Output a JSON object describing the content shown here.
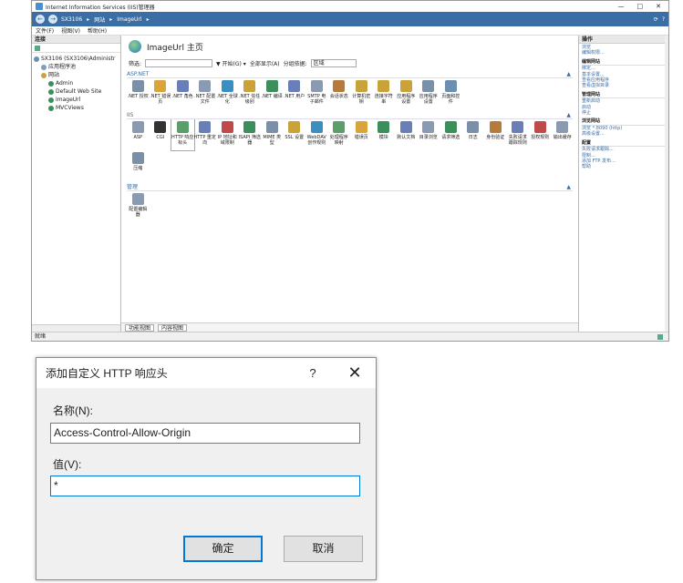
{
  "iis": {
    "title": "Internet Information Services (IIS)管理器",
    "window_controls": [
      "—",
      "□",
      "✕"
    ],
    "breadcrumb": [
      "SX3106",
      "网站",
      "ImageUrl"
    ],
    "menu": [
      "文件(F)",
      "视图(V)",
      "帮助(H)"
    ],
    "connections": {
      "header": "连接",
      "tree": [
        {
          "label": "SX3106 (SX3106\\Administr",
          "level": 0,
          "icon_color": "#6a8fb0"
        },
        {
          "label": "应用程序池",
          "level": 1,
          "icon_color": "#7a9fc0"
        },
        {
          "label": "网站",
          "level": 1,
          "icon_color": "#c9a23a"
        },
        {
          "label": "Admin",
          "level": 2,
          "icon_color": "#3a8f5a"
        },
        {
          "label": "Default Web Site",
          "level": 2,
          "icon_color": "#3a8f5a"
        },
        {
          "label": "ImageUrl",
          "level": 2,
          "icon_color": "#3a8f5a"
        },
        {
          "label": "MVCViews",
          "level": 2,
          "icon_color": "#3a8f5a"
        }
      ]
    },
    "center": {
      "title": "ImageUrl 主页",
      "filter_label": "筛选:",
      "go_label": "▼ 开始(G) ▾",
      "show_all_label": "全部显示(A)",
      "group_label": "分组依据:",
      "group_value": "区域",
      "sections": [
        {
          "name": "ASP.NET",
          "items": [
            {
              "label": ".NET 授权",
              "color": "#7a8fa8"
            },
            {
              "label": ".NET 错误页",
              "color": "#d9a43a"
            },
            {
              "label": ".NET 角色",
              "color": "#6a7fb8"
            },
            {
              "label": ".NET 配置文件",
              "color": "#8a9ab0"
            },
            {
              "label": ".NET 全球化",
              "color": "#3a8fc0"
            },
            {
              "label": ".NET 信任级别",
              "color": "#c9a23a"
            },
            {
              "label": ".NET 编译",
              "color": "#3a8f5a"
            },
            {
              "label": ".NET 用户",
              "color": "#6a7fb8"
            },
            {
              "label": "SMTP 电子邮件",
              "color": "#8a9ab0"
            },
            {
              "label": "会话状态",
              "color": "#b87a3a"
            },
            {
              "label": "计算机密钥",
              "color": "#c9a23a"
            },
            {
              "label": "连接字符串",
              "color": "#c9a23a"
            },
            {
              "label": "应用程序设置",
              "color": "#c9a23a"
            },
            {
              "label": "应用程序设置",
              "color": "#7a8fa8"
            },
            {
              "label": "页面和控件",
              "color": "#6a8fb0"
            }
          ]
        },
        {
          "name": "IIS",
          "items": [
            {
              "label": "ASP",
              "color": "#8a9ab0"
            },
            {
              "label": "CGI",
              "color": "#333333"
            },
            {
              "label": "HTTP 响应标头",
              "color": "#5a9f6a"
            },
            {
              "label": "HTTP 重定向",
              "color": "#6a7fb8"
            },
            {
              "label": "IP 地址和域限制",
              "color": "#c04a4a"
            },
            {
              "label": "ISAPI 筛选器",
              "color": "#3a8f5a"
            },
            {
              "label": "MIME 类型",
              "color": "#7a8fa8"
            },
            {
              "label": "SSL 设置",
              "color": "#c9a23a"
            },
            {
              "label": "WebDAV 创作规则",
              "color": "#3a8fc0"
            },
            {
              "label": "处理程序映射",
              "color": "#5a9f6a"
            },
            {
              "label": "错误页",
              "color": "#d9a43a"
            },
            {
              "label": "模块",
              "color": "#3a8f5a"
            },
            {
              "label": "默认文档",
              "color": "#6a7fb8"
            },
            {
              "label": "目录浏览",
              "color": "#8a9ab0"
            },
            {
              "label": "请求筛选",
              "color": "#3a8f5a"
            },
            {
              "label": "日志",
              "color": "#7a8fa8"
            },
            {
              "label": "身份验证",
              "color": "#b87a3a"
            },
            {
              "label": "失败请求跟踪规则",
              "color": "#6a7fb8"
            },
            {
              "label": "授权规则",
              "color": "#c04a4a"
            },
            {
              "label": "输出缓存",
              "color": "#8a9ab0"
            },
            {
              "label": "压缩",
              "color": "#7a8fa8"
            }
          ]
        },
        {
          "name": "管理",
          "items": [
            {
              "label": "配置编辑器",
              "color": "#8a9ab0"
            }
          ]
        }
      ],
      "bottom_tabs": [
        "功能视图",
        "内容视图"
      ]
    },
    "actions": {
      "header": "操作",
      "groups": [
        {
          "title": "",
          "links": [
            "浏览",
            "编辑权限..."
          ]
        },
        {
          "title": "编辑网站",
          "links": [
            "绑定...",
            "基本设置...",
            "查看应用程序",
            "查看虚拟目录"
          ]
        },
        {
          "title": "管理网站",
          "links": [
            "重新启动",
            "启动",
            "停止"
          ]
        },
        {
          "title": "浏览网站",
          "links": [
            "浏览 *:8090 (http)",
            "高级设置..."
          ]
        },
        {
          "title": "配置",
          "links": [
            "失败请求跟踪...",
            "限制...",
            "添加 FTP 发布..."
          ]
        },
        {
          "title": "",
          "links": [
            "帮助"
          ]
        }
      ]
    },
    "status": "就绪"
  },
  "dialog": {
    "title": "添加自定义 HTTP 响应头",
    "help": "?",
    "close": "✕",
    "name_label": "名称(N):",
    "name_value": "Access-Control-Allow-Origin",
    "value_label": "值(V):",
    "value_value": "*",
    "ok": "确定",
    "cancel": "取消"
  }
}
